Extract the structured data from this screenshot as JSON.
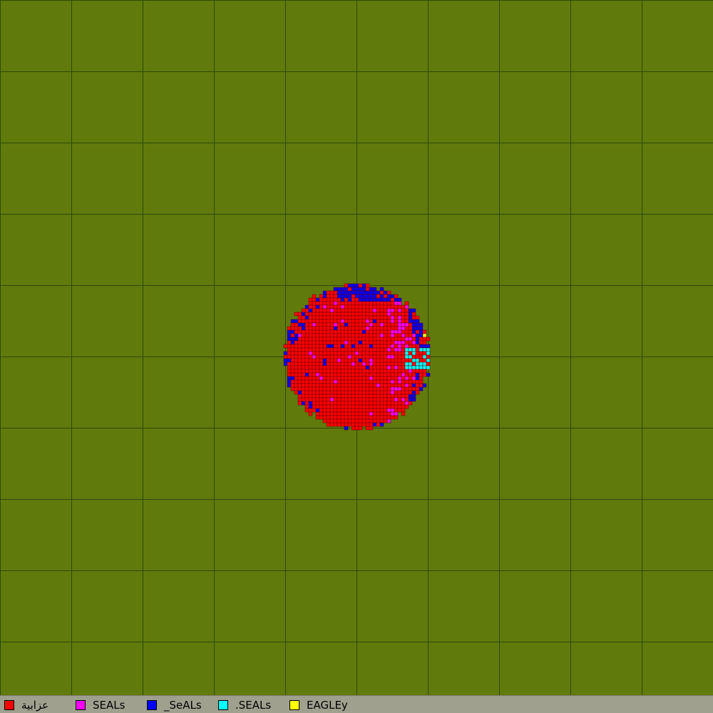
{
  "background_color": "#617a0c",
  "grid_color": "#2b4a0a",
  "legend": [
    {
      "label": "عزابية",
      "color": "#ff0000"
    },
    {
      "label": "SEALs",
      "color": "#ff00ff"
    },
    {
      "label": "_SeALs",
      "color": "#0000ff"
    },
    {
      "label": ".SEALs",
      "color": "#00ffff"
    },
    {
      "label": "EAGLEy",
      "color": "#ffff00"
    }
  ]
}
